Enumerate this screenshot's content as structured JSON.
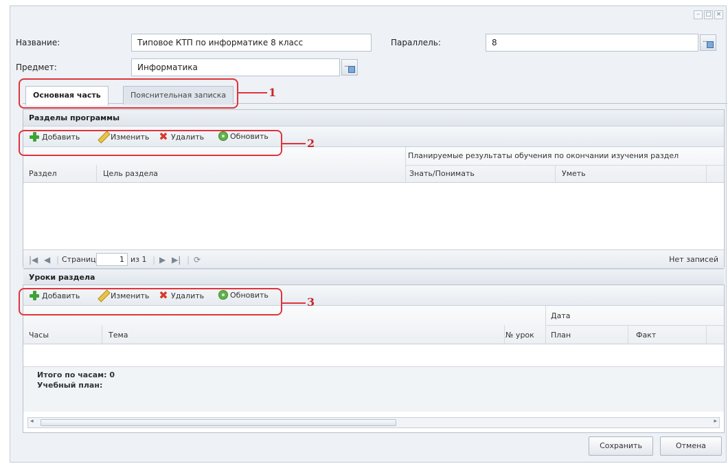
{
  "form": {
    "name_label": "Название:",
    "name_value": "Типовое КТП по информатике 8 класс",
    "parallel_label": "Параллель:",
    "parallel_value": "8",
    "subject_label": "Предмет:",
    "subject_value": "Информатика"
  },
  "tabs": [
    {
      "label": "Основная часть",
      "active": true
    },
    {
      "label": "Пояснительная записка",
      "active": false
    }
  ],
  "sections": {
    "title": "Разделы программы",
    "toolbar": {
      "add": "Добавить",
      "edit": "Изменить",
      "delete": "Удалить",
      "refresh": "Обновить"
    },
    "group_header": "Планируемые результаты обучения по окончании изучения раздел",
    "columns": [
      "Раздел",
      "Цель раздела",
      "Знать/Понимать",
      "Уметь"
    ],
    "pager": {
      "page_label": "Страница",
      "page_value": "1",
      "of_label": "из 1",
      "status": "Нет записей"
    }
  },
  "lessons": {
    "title": "Уроки раздела",
    "toolbar": {
      "add": "Добавить",
      "edit": "Изменить",
      "delete": "Удалить",
      "refresh": "Обновить"
    },
    "group_header": "Дата",
    "columns": [
      "Часы",
      "Тема",
      "№ урок",
      "План",
      "Факт"
    ],
    "total_hours": "Итого по часам: 0",
    "study_plan": "Учебный план:"
  },
  "callouts": [
    "1",
    "2",
    "3"
  ],
  "buttons": {
    "save": "Сохранить",
    "cancel": "Отмена"
  },
  "colors": {
    "callout": "#e0323a",
    "add": "#3ea336",
    "delete": "#d63a2a"
  }
}
